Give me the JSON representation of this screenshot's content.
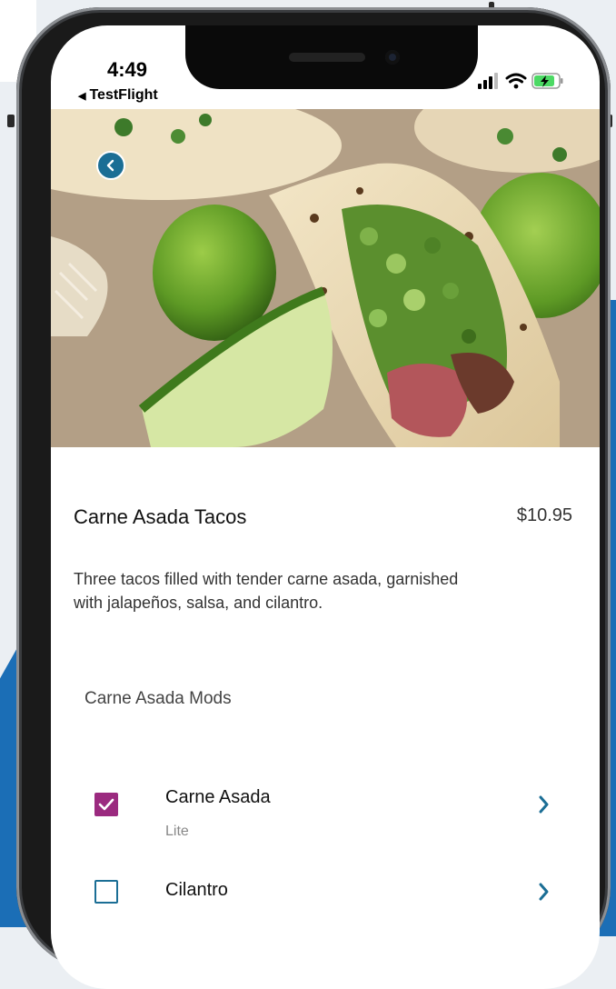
{
  "status_bar": {
    "time": "4:49",
    "back_app_label": "TestFlight",
    "icons": [
      "signal-icon",
      "wifi-icon",
      "battery-charging-icon"
    ]
  },
  "hero": {
    "image": "carne-asada-tacos-photo",
    "back_icon": "chevron-left-icon"
  },
  "item": {
    "title": "Carne Asada Tacos",
    "price": "$10.95",
    "description": "Three tacos filled with tender carne asada, garnished with jalapeños, salsa, and cilantro."
  },
  "mods": {
    "heading": "Carne Asada Mods",
    "options": [
      {
        "name": "Carne Asada",
        "sub": "Lite",
        "checked": true
      },
      {
        "name": "Cilantro",
        "sub": "",
        "checked": false
      }
    ]
  },
  "colors": {
    "accent_teal": "#1b6e95",
    "checkbox_purple": "#9b2a7f",
    "background_blue": "#1b6eb6"
  }
}
